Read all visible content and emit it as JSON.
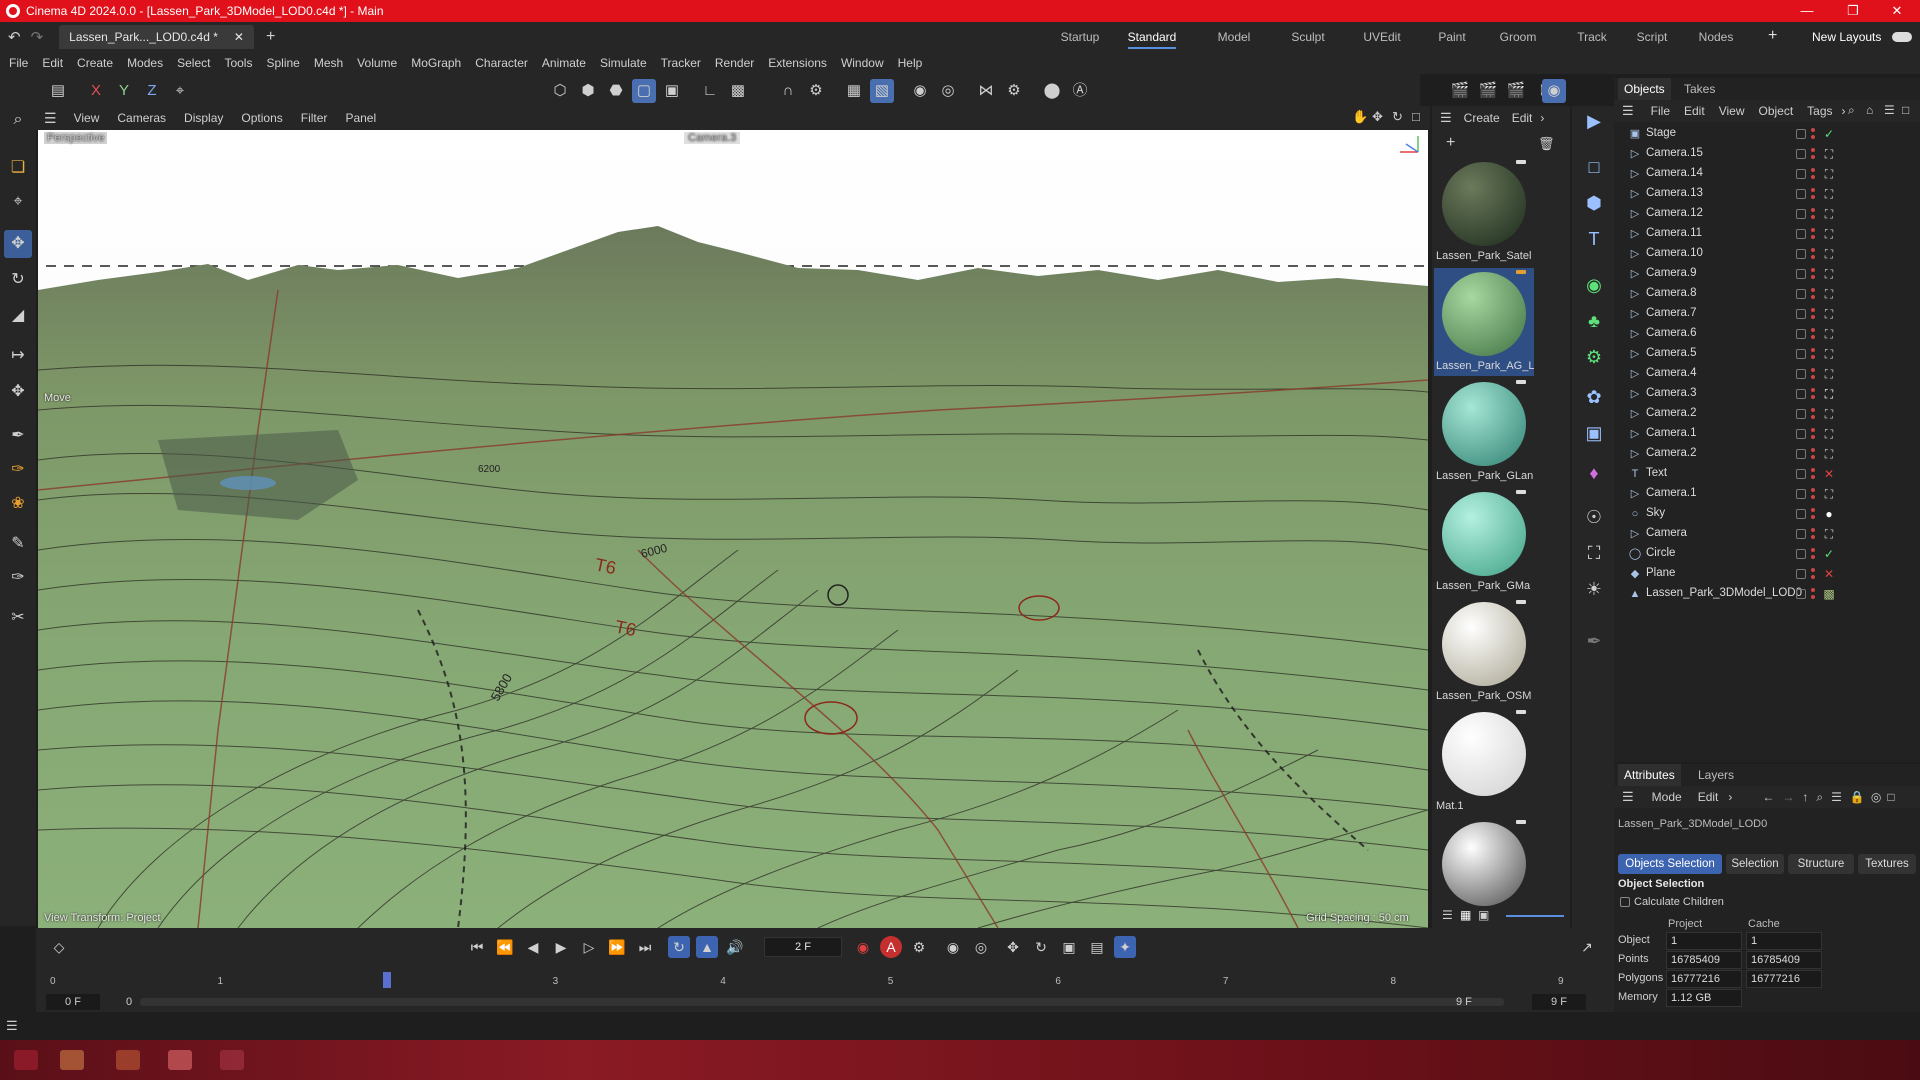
{
  "window": {
    "title": "Cinema 4D 2024.0.0 - [Lassen_Park_3DModel_LOD0.c4d *] - Main"
  },
  "doc_tab": {
    "label": "Lassen_Park..._LOD0.c4d *"
  },
  "layouts": {
    "items": [
      "Startup",
      "Standard",
      "Model",
      "Sculpt",
      "UVEdit",
      "Paint",
      "Groom",
      "Track",
      "Script",
      "Nodes"
    ],
    "active": "Standard",
    "new_layouts": "New Layouts"
  },
  "menu": [
    "File",
    "Edit",
    "Create",
    "Modes",
    "Select",
    "Tools",
    "Spline",
    "Mesh",
    "Volume",
    "MoGraph",
    "Character",
    "Animate",
    "Simulate",
    "Tracker",
    "Render",
    "Extensions",
    "Window",
    "Help"
  ],
  "toolbar": {
    "axes": [
      "X",
      "Y",
      "Z"
    ]
  },
  "viewport_menu": [
    "View",
    "Cameras",
    "Display",
    "Options",
    "Filter",
    "Panel"
  ],
  "viewport": {
    "label": "Perspective",
    "camera": "Camera.3",
    "tool": "Move",
    "view_transform": "View Transform: Project",
    "grid_spacing": "Grid Spacing : 50 cm",
    "map_labels": [
      "T6",
      "T6",
      "6000",
      "5800",
      "6200"
    ]
  },
  "material_menu": [
    "Create",
    "Edit"
  ],
  "materials": [
    {
      "name": "Lassen_Park_Satel",
      "color1": "#6b7a5a",
      "color2": "#1b2a1c"
    },
    {
      "name": "Lassen_Park_AG_L",
      "color1": "#a8d8a0",
      "color2": "#3e7042"
    },
    {
      "name": "Lassen_Park_GLan",
      "color1": "#a6e6d6",
      "color2": "#2e8070"
    },
    {
      "name": "Lassen_Park_GMa",
      "color1": "#b4f0e0",
      "color2": "#3ea084"
    },
    {
      "name": "Lassen_Park_OSM",
      "color1": "#ffffff",
      "color2": "#a8a490"
    },
    {
      "name": "Mat.1",
      "color1": "#ffffff",
      "color2": "#d0d0d0"
    },
    {
      "name": "",
      "color1": "#ffffff",
      "color2": "#4a4a4a"
    }
  ],
  "objects_panel": {
    "tabs": [
      "Objects",
      "Takes"
    ],
    "menu": [
      "File",
      "Edit",
      "View",
      "Object",
      "Tags"
    ],
    "items": [
      {
        "name": "Stage",
        "icon": "stage-icon",
        "tag": "check"
      },
      {
        "name": "Camera.15",
        "icon": "camera-icon",
        "tag": "target"
      },
      {
        "name": "Camera.14",
        "icon": "camera-icon",
        "tag": "target"
      },
      {
        "name": "Camera.13",
        "icon": "camera-icon",
        "tag": "target"
      },
      {
        "name": "Camera.12",
        "icon": "camera-icon",
        "tag": "target"
      },
      {
        "name": "Camera.11",
        "icon": "camera-icon",
        "tag": "target"
      },
      {
        "name": "Camera.10",
        "icon": "camera-icon",
        "tag": "target"
      },
      {
        "name": "Camera.9",
        "icon": "camera-icon",
        "tag": "target"
      },
      {
        "name": "Camera.8",
        "icon": "camera-icon",
        "tag": "target"
      },
      {
        "name": "Camera.7",
        "icon": "camera-icon",
        "tag": "target"
      },
      {
        "name": "Camera.6",
        "icon": "camera-icon",
        "tag": "target"
      },
      {
        "name": "Camera.5",
        "icon": "camera-icon",
        "tag": "target"
      },
      {
        "name": "Camera.4",
        "icon": "camera-icon",
        "tag": "target"
      },
      {
        "name": "Camera.3",
        "icon": "camera-icon",
        "tag": "target-active"
      },
      {
        "name": "Camera.2",
        "icon": "camera-icon",
        "tag": "target"
      },
      {
        "name": "Camera.1",
        "icon": "camera-icon",
        "tag": "target"
      },
      {
        "name": "Camera.2",
        "icon": "camera-icon",
        "tag": "target"
      },
      {
        "name": "Text",
        "icon": "text-icon",
        "tag": "cross"
      },
      {
        "name": "Camera.1",
        "icon": "camera-icon",
        "tag": "target"
      },
      {
        "name": "Sky",
        "icon": "sky-icon",
        "tag": "sphere"
      },
      {
        "name": "Camera",
        "icon": "camera-icon",
        "tag": "target"
      },
      {
        "name": "Circle",
        "icon": "circle-icon",
        "tag": "check"
      },
      {
        "name": "Plane",
        "icon": "plane-icon",
        "tag": "cross"
      },
      {
        "name": "Lassen_Park_3DModel_LOD0",
        "icon": "mesh-icon",
        "tag": "mat"
      }
    ]
  },
  "attributes": {
    "tabs": [
      "Attributes",
      "Layers"
    ],
    "menu": [
      "Mode",
      "Edit"
    ],
    "object_name": "Lassen_Park_3DModel_LOD0",
    "buttons": [
      "Objects Selection",
      "Selection",
      "Structure",
      "Textures"
    ],
    "section": "Object Selection",
    "calc_children": "Calculate Children",
    "col_project": "Project",
    "col_cache": "Cache",
    "rows": [
      {
        "label": "Object",
        "project": "1",
        "cache": "1"
      },
      {
        "label": "Points",
        "project": "16785409",
        "cache": "16785409"
      },
      {
        "label": "Polygons",
        "project": "16777216",
        "cache": "16777216"
      },
      {
        "label": "Memory",
        "project": "1.12 GB",
        "cache": ""
      }
    ]
  },
  "timeline": {
    "frame": "2 F",
    "start": "0 F",
    "start2": "0 F",
    "end": "9 F",
    "end2": "9 F",
    "ticks": [
      "0",
      "1",
      "2",
      "3",
      "4",
      "5",
      "6",
      "7",
      "8",
      "9"
    ],
    "current": 2,
    "max": 9
  },
  "colors": {
    "accent": "#4a6fb0",
    "title_bar": "#e0111b",
    "terrain": "#7fa06a"
  }
}
